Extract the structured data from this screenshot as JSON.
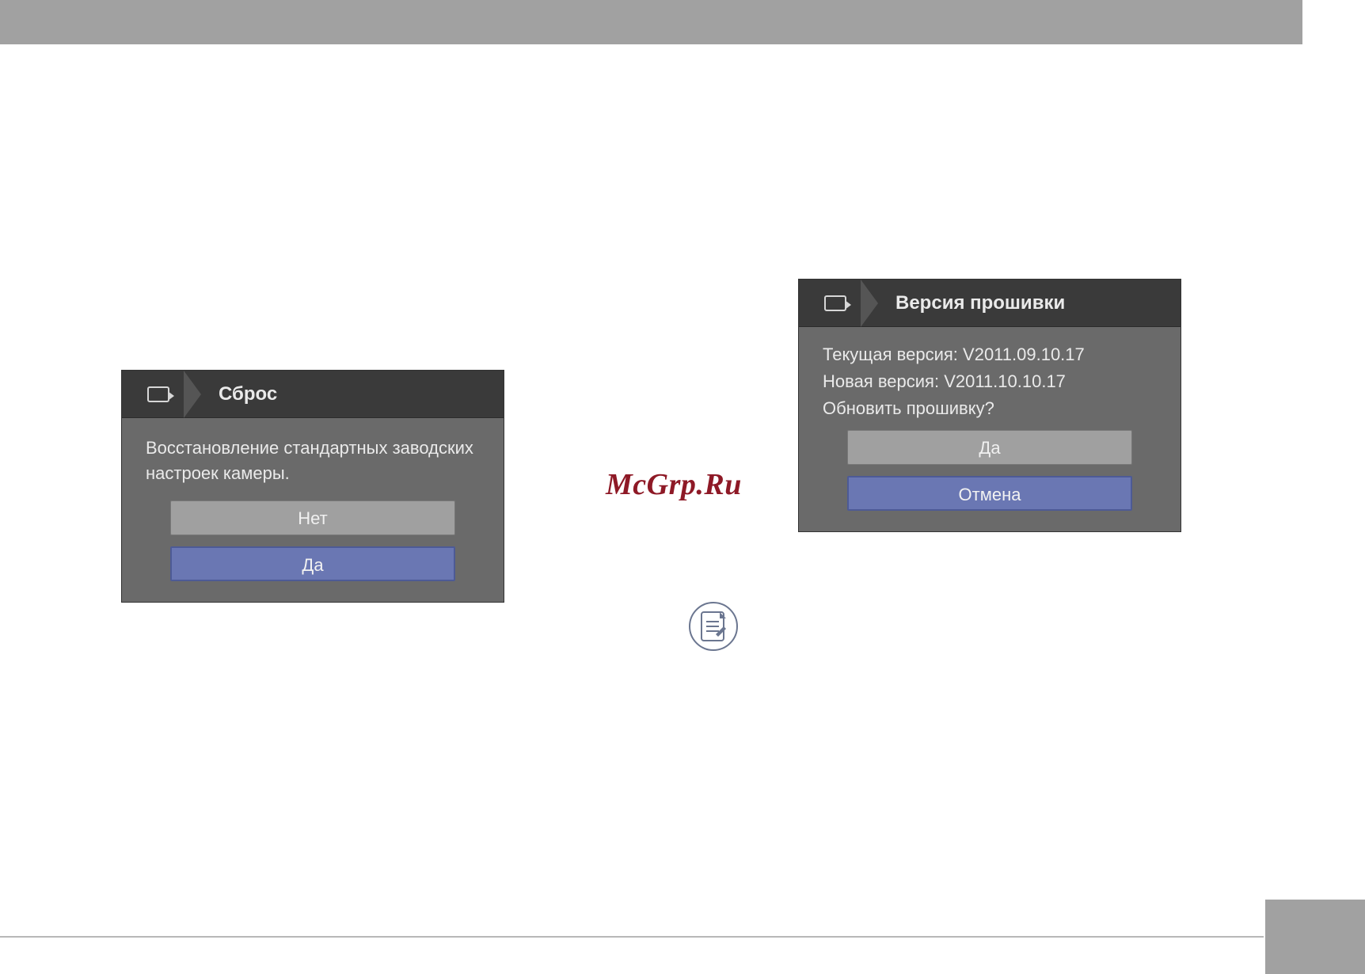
{
  "watermark": "McGrp.Ru",
  "panel_reset": {
    "title": "Сброс",
    "message": "Восстановление стандартных заводских настроек камеры.",
    "btn_no": "Нет",
    "btn_yes": "Да"
  },
  "panel_fw": {
    "title": "Версия прошивки",
    "current_label": "Текущая версия:",
    "current_value": "V2011.09.10.17",
    "new_label": "Новая версия:",
    "new_value": "V2011.10.10.17",
    "question": "Обновить прошивку?",
    "btn_yes": "Да",
    "btn_cancel": "Отмена"
  }
}
